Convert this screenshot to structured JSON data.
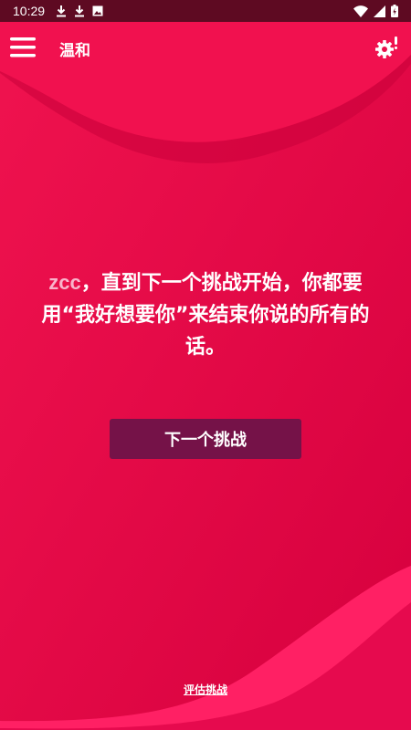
{
  "status_bar": {
    "time": "10:29",
    "left_icons": [
      "download-icon",
      "download-icon",
      "image-icon"
    ],
    "right_icons": [
      "wifi-icon",
      "signal-icon",
      "battery-icon"
    ]
  },
  "app_bar": {
    "title": "温和",
    "menu_icon": "hamburger-menu-icon",
    "settings_icon": "gear-alert-icon"
  },
  "challenge": {
    "player": "zcc",
    "text": "，直到下一个挑战开始，你都要用“我好想要你”来结束你说的所有的话。"
  },
  "next_button": {
    "label": "下一个挑战"
  },
  "rate_link": {
    "label": "评估挑战"
  },
  "colors": {
    "background": "#E20849",
    "status_bar": "#5E0A22",
    "button": "#751248",
    "player_name": "#F8B3CB"
  }
}
